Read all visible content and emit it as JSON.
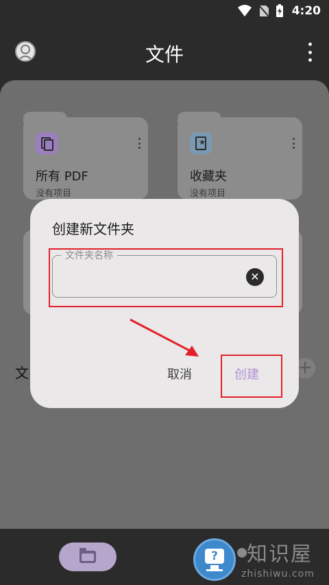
{
  "status_bar": {
    "time": "4:20"
  },
  "app_bar": {
    "title": "文件"
  },
  "cards": [
    {
      "title": "所有 PDF",
      "subtitle": "没有项目",
      "icon": "pdf-files-icon",
      "icon_color": "#9b7fbf"
    },
    {
      "title": "收藏夹",
      "subtitle": "没有项目",
      "icon": "star-file-icon",
      "icon_color": "#7c99b3"
    }
  ],
  "section": {
    "label": "文"
  },
  "dialog": {
    "title": "创建新文件夹",
    "input": {
      "label": "文件夹名称",
      "value": ""
    },
    "cancel_label": "取消",
    "create_label": "创建"
  },
  "watermark": {
    "logo_text": "知识屋",
    "url": "zhishiwu.com"
  },
  "help_badge": {
    "symbol": "?"
  },
  "colors": {
    "accent": "#b493d4",
    "annotation_red": "#e2202a"
  }
}
